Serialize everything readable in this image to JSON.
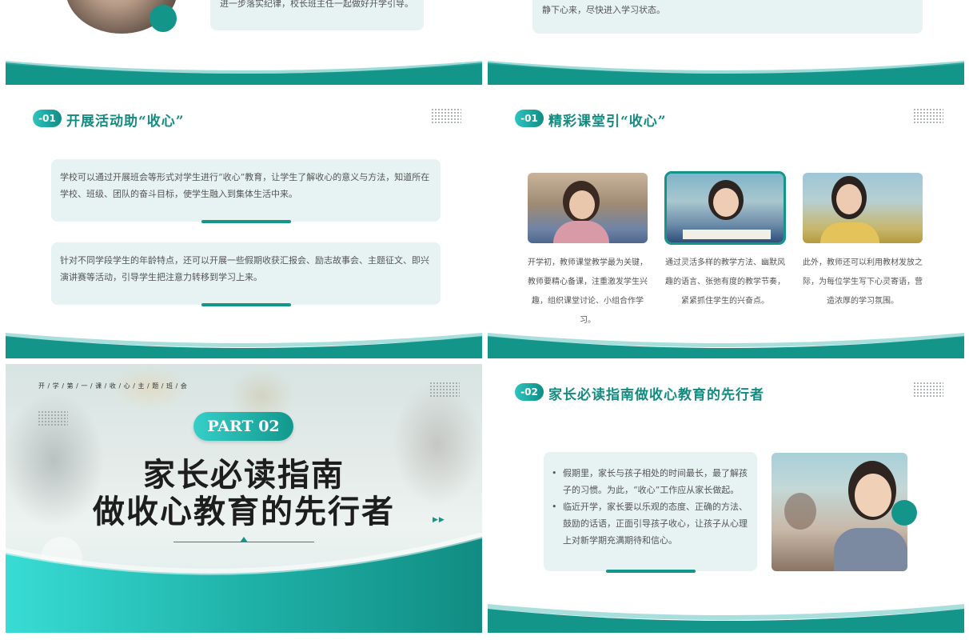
{
  "top_left": {
    "text": "进一步落实纪律，校长班主任一起做好开学引导。"
  },
  "top_right": {
    "text": "要求学生将精力逐步转移到学习上，这样既使学生巩固了假期知识、进行了复习，而且能使学生静下心来，尽快进入学习状态。"
  },
  "mid_left": {
    "tag": "-01",
    "title": "开展活动助“收心”",
    "box1": "学校可以通过开展班会等形式对学生进行“收心”教育，让学生了解收心的意义与方法，知道所在学校、班级、团队的奋斗目标，使学生融入到集体生活中来。",
    "box2": "针对不同学段学生的年龄特点，还可以开展一些假期收获汇报会、励志故事会、主题征文、即兴演讲赛等活动，引导学生把注意力转移到学习上来。"
  },
  "mid_right": {
    "tag": "-01",
    "title": "精彩课堂引“收心”",
    "captions": [
      "开学初，教师课堂教学最为关键，教师要精心备课，注重激发学生兴趣，组织课堂讨论、小组合作学习。",
      "通过灵活多样的教学方法、幽默风趣的语言、张弛有度的教学节奏，紧紧抓住学生的兴奋点。",
      "此外，教师还可以利用教材发放之际，为每位学生写下心灵寄语，营造浓厚的学习氛围。"
    ]
  },
  "bot_left": {
    "kicker": "开 / 学 / 第 / 一 / 课 / 收 / 心 / 主 / 题 / 班 / 会",
    "part": "PART 02",
    "headline1": "家长必读指南",
    "headline2": "做收心教育的先行者"
  },
  "bot_right": {
    "tag": "-02",
    "title": "家长必读指南做收心教育的先行者",
    "bullets": [
      "假期里，家长与孩子相处的时间最长，最了解孩子的习惯。为此，“收心”工作应从家长做起。",
      "临近开学，家长要以乐观的态度、正确的方法、鼓励的话语，正面引导孩子收心，让孩子从心理上对新学期充满期待和信心。"
    ]
  },
  "colors": {
    "primary": "#148b80",
    "accent": "#2fc4c0",
    "panel": "#e6f3f2"
  },
  "icons": [
    "dot-grid-icon",
    "play-arrows-icon",
    "triangle-marker-icon"
  ]
}
